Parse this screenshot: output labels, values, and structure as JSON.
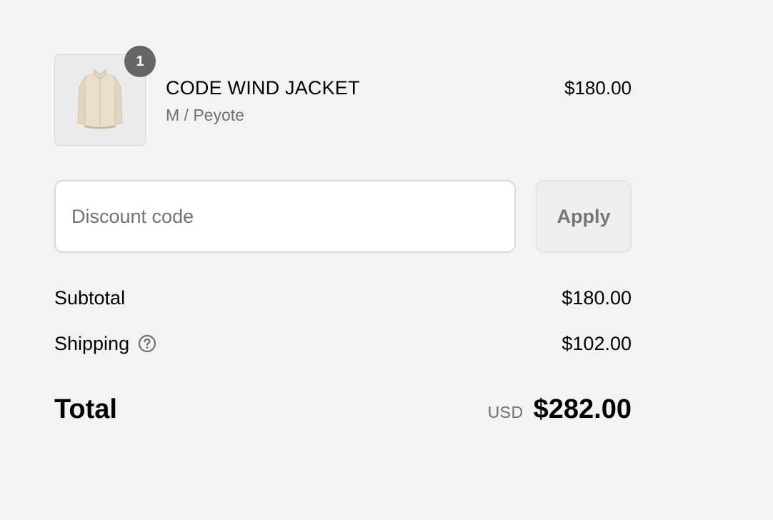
{
  "line_item": {
    "quantity": "1",
    "title": "CODE WIND JACKET",
    "variant": "M / Peyote",
    "price": "$180.00",
    "image_icon": "jacket-image"
  },
  "discount": {
    "placeholder": "Discount code",
    "value": "",
    "apply_label": "Apply"
  },
  "totals": {
    "subtotal_label": "Subtotal",
    "subtotal_value": "$180.00",
    "shipping_label": "Shipping",
    "shipping_value": "$102.00",
    "shipping_help_icon": "question-circle-icon",
    "total_label": "Total",
    "currency": "USD",
    "total_value": "$282.00"
  },
  "colors": {
    "background": "#f3f3f3",
    "badge": "#666666",
    "muted_text": "#707070",
    "apply_button_bg": "#efefef",
    "apply_button_text": "#777777"
  }
}
